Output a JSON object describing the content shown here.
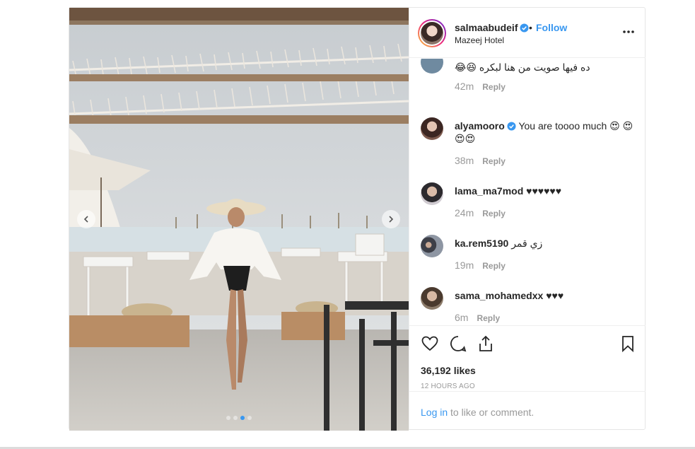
{
  "header": {
    "username": "salmaabudeif",
    "separator": "•",
    "follow_label": "Follow",
    "location": "Mazeej Hotel"
  },
  "comments": [
    {
      "user": "",
      "text": "ده فيها صويت من هنا لبكره 😆😂",
      "time": "42m",
      "reply": "Reply"
    },
    {
      "user": "alyamooro",
      "verified": true,
      "text": "You are toooo much 😍 😍😍😍",
      "time": "38m",
      "reply": "Reply"
    },
    {
      "user": "lama_ma7mod",
      "text": "♥♥♥♥♥♥",
      "time": "24m",
      "reply": "Reply"
    },
    {
      "user": "ka.rem5190",
      "text": "زي قمر",
      "time": "19m",
      "reply": "Reply"
    },
    {
      "user": "sama_mohamedxx",
      "text": "♥♥♥",
      "time": "6m",
      "reply": "Reply"
    }
  ],
  "actions": {
    "likes": "36,192 likes",
    "time_ago": "12 HOURS AGO"
  },
  "login": {
    "link": "Log in",
    "rest": " to like or comment."
  },
  "carousel": {
    "total": 4,
    "active_index": 2
  },
  "colors": {
    "link": "#3897f0",
    "muted": "#999999",
    "text": "#262626"
  }
}
